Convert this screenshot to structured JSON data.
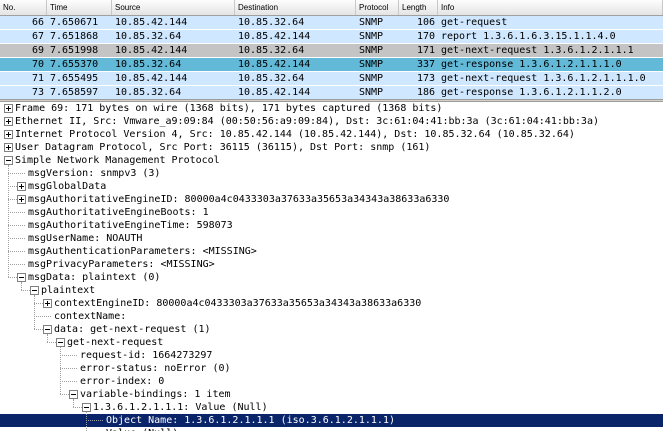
{
  "columns": [
    "No.",
    "Time",
    "Source",
    "Destination",
    "Protocol",
    "Length",
    "Info"
  ],
  "packets": [
    {
      "no": "66",
      "time": "7.650671",
      "src": "10.85.42.144",
      "dst": "10.85.32.64",
      "proto": "SNMP",
      "len": "106",
      "info": "get-request",
      "bg": "#cfe7ff",
      "fg": "#000000"
    },
    {
      "no": "67",
      "time": "7.651868",
      "src": "10.85.32.64",
      "dst": "10.85.42.144",
      "proto": "SNMP",
      "len": "170",
      "info": "report 1.3.6.1.6.3.15.1.1.4.0",
      "bg": "#cfe7ff",
      "fg": "#000000"
    },
    {
      "no": "69",
      "time": "7.651998",
      "src": "10.85.42.144",
      "dst": "10.85.32.64",
      "proto": "SNMP",
      "len": "171",
      "info": "get-next-request 1.3.6.1.2.1.1.1",
      "bg": "#c4c4c4",
      "fg": "#000000"
    },
    {
      "no": "70",
      "time": "7.655370",
      "src": "10.85.32.64",
      "dst": "10.85.42.144",
      "proto": "SNMP",
      "len": "337",
      "info": "get-response 1.3.6.1.2.1.1.1.0",
      "bg": "#62b9d8",
      "fg": "#000000"
    },
    {
      "no": "71",
      "time": "7.655495",
      "src": "10.85.42.144",
      "dst": "10.85.32.64",
      "proto": "SNMP",
      "len": "173",
      "info": "get-next-request 1.3.6.1.2.1.1.1.0",
      "bg": "#cfe7ff",
      "fg": "#000000"
    },
    {
      "no": "73",
      "time": "7.658597",
      "src": "10.85.32.64",
      "dst": "10.85.42.144",
      "proto": "SNMP",
      "len": "186",
      "info": "get-response 1.3.6.1.2.1.1.2.0",
      "bg": "#cfe7ff",
      "fg": "#000000"
    }
  ],
  "tree": [
    {
      "text": "Frame 69: 171 bytes on wire (1368 bits), 171 bytes captured (1368 bits)",
      "toggle": "plus",
      "level": 0
    },
    {
      "text": "Ethernet II, Src: Vmware_a9:09:84 (00:50:56:a9:09:84), Dst: 3c:61:04:41:bb:3a (3c:61:04:41:bb:3a)",
      "toggle": "plus",
      "level": 0
    },
    {
      "text": "Internet Protocol Version 4, Src: 10.85.42.144 (10.85.42.144), Dst: 10.85.32.64 (10.85.32.64)",
      "toggle": "plus",
      "level": 0
    },
    {
      "text": "User Datagram Protocol, Src Port: 36115 (36115), Dst Port: snmp (161)",
      "toggle": "plus",
      "level": 0
    },
    {
      "text": "Simple Network Management Protocol",
      "toggle": "minus",
      "level": 0
    },
    {
      "text": "msgVersion: snmpv3 (3)",
      "toggle": "",
      "level": 1
    },
    {
      "text": "msgGlobalData",
      "toggle": "plus",
      "level": 1
    },
    {
      "text": "msgAuthoritativeEngineID: 80000a4c0433303a37633a35653a34343a38633a6330",
      "toggle": "plus",
      "level": 1
    },
    {
      "text": "msgAuthoritativeEngineBoots: 1",
      "toggle": "",
      "level": 1
    },
    {
      "text": "msgAuthoritativeEngineTime: 598073",
      "toggle": "",
      "level": 1
    },
    {
      "text": "msgUserName: NOAUTH",
      "toggle": "",
      "level": 1
    },
    {
      "text": "msgAuthenticationParameters: <MISSING>",
      "toggle": "",
      "level": 1
    },
    {
      "text": "msgPrivacyParameters: <MISSING>",
      "toggle": "",
      "level": 1
    },
    {
      "text": "msgData: plaintext (0)",
      "toggle": "minus",
      "level": 1
    },
    {
      "text": "plaintext",
      "toggle": "minus",
      "level": 2
    },
    {
      "text": "contextEngineID: 80000a4c0433303a37633a35653a34343a38633a6330",
      "toggle": "plus",
      "level": 3
    },
    {
      "text": "contextName:",
      "toggle": "",
      "level": 3
    },
    {
      "text": "data: get-next-request (1)",
      "toggle": "minus",
      "level": 3
    },
    {
      "text": "get-next-request",
      "toggle": "minus",
      "level": 4
    },
    {
      "text": "request-id: 1664273297",
      "toggle": "",
      "level": 5
    },
    {
      "text": "error-status: noError (0)",
      "toggle": "",
      "level": 5
    },
    {
      "text": "error-index: 0",
      "toggle": "",
      "level": 5
    },
    {
      "text": "variable-bindings: 1 item",
      "toggle": "minus",
      "level": 5
    },
    {
      "text": "1.3.6.1.2.1.1.1: Value (Null)",
      "toggle": "minus",
      "level": 6
    },
    {
      "text": "Object Name: 1.3.6.1.2.1.1.1 (iso.3.6.1.2.1.1.1)",
      "toggle": "",
      "level": 7,
      "selected": true
    },
    {
      "text": "Value (Null)",
      "toggle": "",
      "level": 7
    }
  ]
}
